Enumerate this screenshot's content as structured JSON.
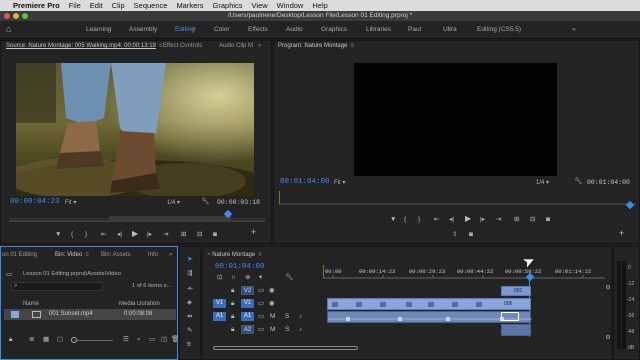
{
  "menubar": {
    "app_name": "Premiere Pro",
    "items": [
      "File",
      "Edit",
      "Clip",
      "Sequence",
      "Markers",
      "Graphics",
      "View",
      "Window",
      "Help"
    ]
  },
  "titlebar": {
    "path": "/Users/paulnene/Desktop/Lesson File/Lesson 01 Editing.prproj *"
  },
  "workspaces": {
    "items": [
      "Learning",
      "Assembly",
      "Editing",
      "Color",
      "Effects",
      "Audio",
      "Graphics",
      "Libraries",
      "Paul",
      "Ultra",
      "Editing (CS5.5)"
    ],
    "active": "Editing"
  },
  "source_monitor": {
    "tab_label": "Source: Nature Montage: 005 Walking.mp4: 00:00:13:19",
    "tab_effect_controls": "Effect Controls",
    "tab_audio_clip": "Audio Clip M",
    "timecode": "00:00:04:23",
    "fit": "Fit",
    "resolution": "1/4",
    "duration": "00:00:03:18"
  },
  "program_monitor": {
    "tab_label": "Program: Nature Montage",
    "timecode": "00:01:04:00",
    "fit": "Fit",
    "resolution": "1/4",
    "duration": "00:01:04:00"
  },
  "project_panel": {
    "tab_editing": "on 01 Editing",
    "tab_bin_video": "Bin: Video",
    "tab_bin_assets": "Bin: Assets",
    "tab_info": "Info",
    "path": "Lesson 01 Editing.prproj\\Assets\\Video",
    "items_count": "1 of 6 items s...",
    "col_name": "Name",
    "col_duration": "Media Duration",
    "row_name": "001 Sunset.mp4",
    "row_duration": "0:00:08:08"
  },
  "timeline": {
    "tab_label": "Nature Montage",
    "timecode": "00:01:04:00",
    "ruler": [
      "00:00",
      "00:00:14:23",
      "00:00:29:23",
      "00:00:44:22",
      "00:00:59:22",
      "00:01:14:22"
    ],
    "tracks": [
      "V2",
      "V1",
      "A1",
      "A2"
    ],
    "source_patch": [
      "V1",
      "A1"
    ],
    "clip_label_v2": "001",
    "clip_label_v1": "006"
  },
  "audio_meter": {
    "labels": [
      "0",
      "-12",
      "-24",
      "-36",
      "-48",
      "dB"
    ]
  },
  "colors": {
    "accent": "#3c8cf0",
    "clip_video": "#8aa6d9",
    "clip_audio": "#6e88b8",
    "panel": "#232323"
  }
}
